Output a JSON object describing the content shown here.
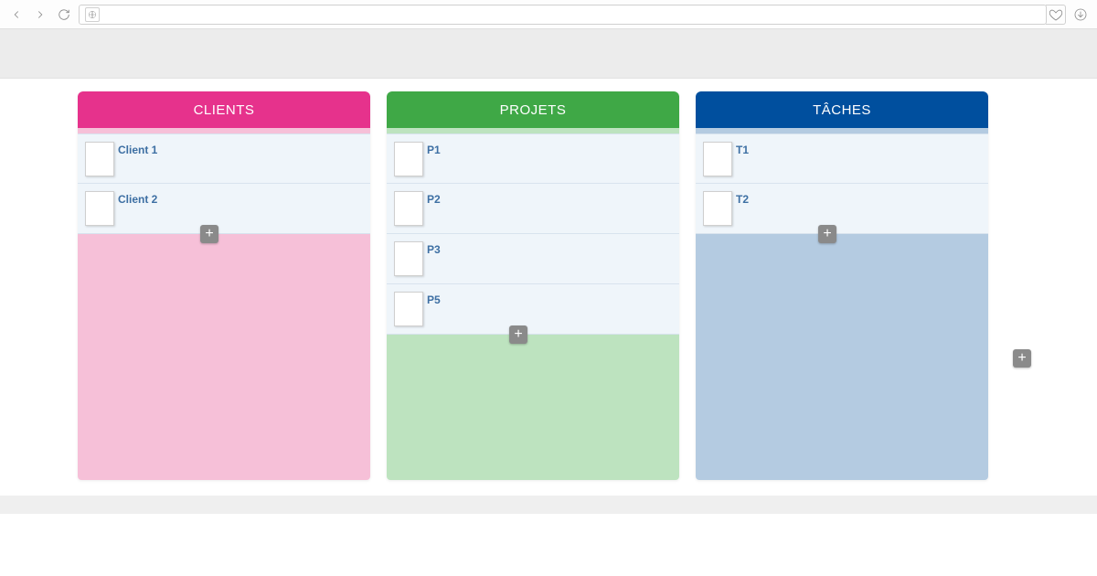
{
  "browser": {
    "url": ""
  },
  "columns": [
    {
      "key": "clients",
      "title": "CLIENTS",
      "theme": "col-pink",
      "items": [
        {
          "label": "Client 1"
        },
        {
          "label": "Client 2"
        }
      ]
    },
    {
      "key": "projets",
      "title": "PROJETS",
      "theme": "col-green",
      "items": [
        {
          "label": "P1"
        },
        {
          "label": "P2"
        },
        {
          "label": "P3"
        },
        {
          "label": "P5"
        }
      ]
    },
    {
      "key": "taches",
      "title": "TÂCHES",
      "theme": "col-blue",
      "items": [
        {
          "label": "T1"
        },
        {
          "label": "T2"
        }
      ]
    }
  ]
}
